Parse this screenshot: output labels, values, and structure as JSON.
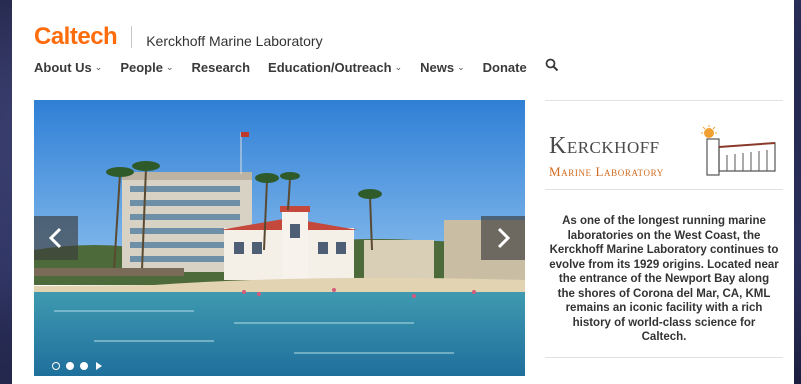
{
  "header": {
    "logo_text": "Caltech",
    "lab_name": "Kerckhoff Marine Laboratory"
  },
  "nav": {
    "items": [
      {
        "label": "About Us",
        "dropdown": true
      },
      {
        "label": "People",
        "dropdown": true
      },
      {
        "label": "Research",
        "dropdown": false
      },
      {
        "label": "Education/Outreach",
        "dropdown": true
      },
      {
        "label": "News",
        "dropdown": true
      },
      {
        "label": "Donate",
        "dropdown": false
      }
    ],
    "search_icon": "search-icon"
  },
  "carousel": {
    "prev_icon": "chevron-left-icon",
    "next_icon": "chevron-right-icon",
    "slides_visible_indicators": 3,
    "active_index": 1,
    "play_icon": "play-icon"
  },
  "sidebar": {
    "logo_title": "Kerckhoff",
    "logo_subtitle": "Marine Laboratory",
    "blurb": "As one of the longest running marine laboratories on the West Coast, the Kerckhoff Marine Laboratory continues to evolve from its 1929 origins. Located near the entrance of the Newport Bay along the shores of Corona del Mar, CA, KML remains an iconic facility with a rich history of world-class science for Caltech."
  },
  "colors": {
    "brand_orange": "#FF6C0C",
    "sidebar_subtitle": "#d26a1e",
    "nav_text": "#3a3a3a"
  }
}
